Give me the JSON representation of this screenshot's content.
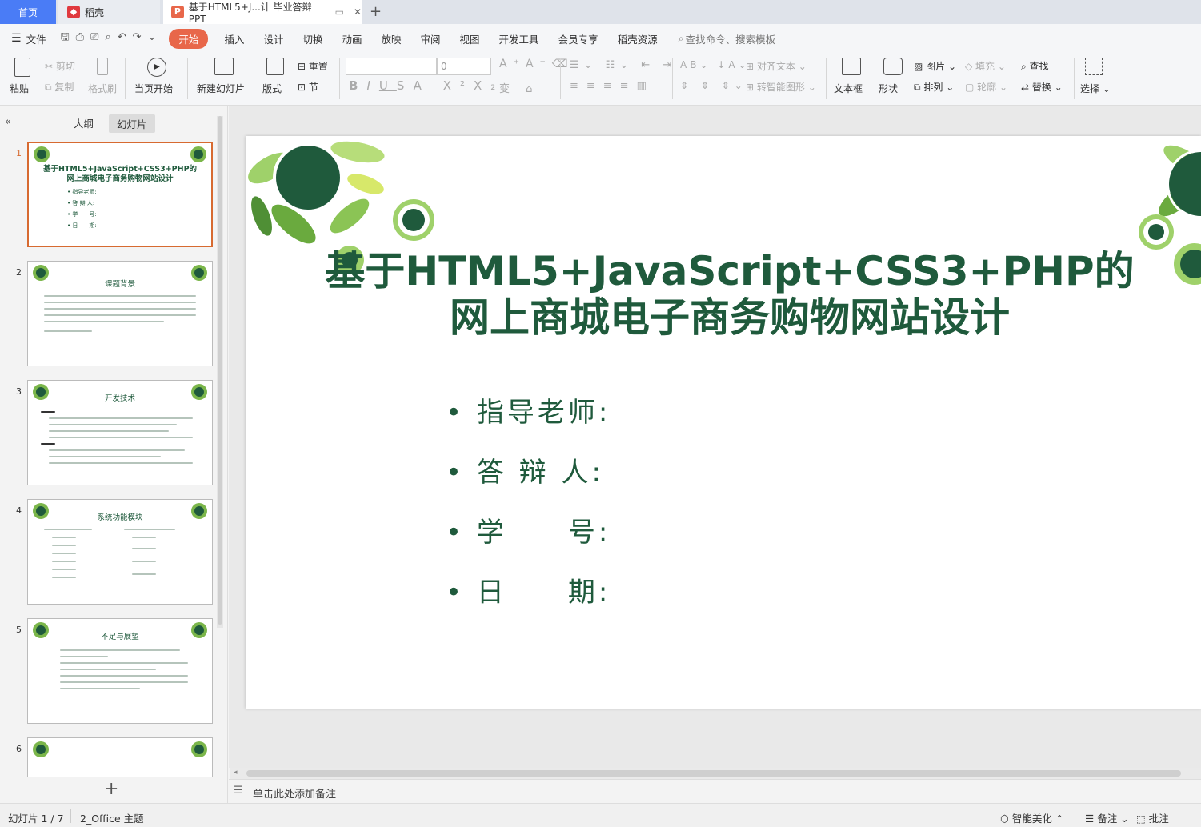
{
  "tabs": {
    "home": "首页",
    "daoke": "稻壳",
    "doc": "基于HTML5+J...计 毕业答辩PPT",
    "add": "+"
  },
  "menu": {
    "file": "文件",
    "items": [
      "开始",
      "插入",
      "设计",
      "切换",
      "动画",
      "放映",
      "审阅",
      "视图",
      "开发工具",
      "会员专享",
      "稻壳资源"
    ],
    "search": "查找命令、搜索模板"
  },
  "ribbon": {
    "paste": "粘贴",
    "cut": "剪切",
    "copy": "复制",
    "format_painter": "格式刷",
    "start_from_current": "当页开始",
    "new_slide": "新建幻灯片",
    "layout": "版式",
    "reset": "重置",
    "section": "节",
    "font_size": "0",
    "align_text": "对齐文本",
    "smart_shape": "转智能图形",
    "textbox": "文本框",
    "shape": "形状",
    "picture": "图片",
    "arrange": "排列",
    "fill": "填充",
    "outline": "轮廓",
    "find": "查找",
    "replace": "替换",
    "select": "选择"
  },
  "panel": {
    "outline_tab": "大纲",
    "slides_tab": "幻灯片",
    "add": "+"
  },
  "thumbnails": [
    {
      "num": "1",
      "title": "基于HTML5+JavaScript+CSS3+PHP的",
      "title2": "网上商城电子商务购物网站设计",
      "lines": [
        "• 指导老师:",
        "• 答 辩 人:",
        "• 学　　号:",
        "• 日　　期:"
      ]
    },
    {
      "num": "2",
      "title": "课题背景"
    },
    {
      "num": "3",
      "title": "开发技术"
    },
    {
      "num": "4",
      "title": "系统功能模块"
    },
    {
      "num": "5",
      "title": "不足与展望"
    },
    {
      "num": "6",
      "title": ""
    }
  ],
  "slide": {
    "title_line1": "基于HTML5+JavaScript+CSS3+PHP的",
    "title_line2": "网上商城电子商务购物网站设计",
    "bullets": [
      "指导老师:",
      "答 辩 人:",
      "学　　号:",
      "日　　期:"
    ]
  },
  "notes_placeholder": "单击此处添加备注",
  "status": {
    "slide_count": "幻灯片 1 / 7",
    "theme": "2_Office 主题",
    "beautify": "智能美化",
    "notes": "备注",
    "comment": "批注"
  },
  "colors": {
    "accent": "#e8674a",
    "title_green": "#1f5a3c",
    "home_tab": "#4a7cf6"
  }
}
